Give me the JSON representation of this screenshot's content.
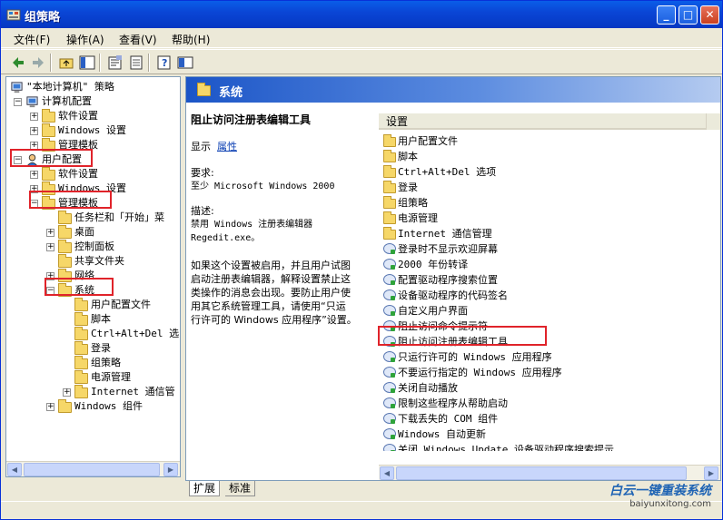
{
  "window": {
    "title": "组策略"
  },
  "menu": [
    "文件(F)",
    "操作(A)",
    "查看(V)",
    "帮助(H)"
  ],
  "tree": [
    {
      "label": "\"本地计算机\" 策略",
      "level": 0,
      "exp": "",
      "icon": "computer"
    },
    {
      "label": "计算机配置",
      "level": 1,
      "exp": "-",
      "icon": "computer"
    },
    {
      "label": "软件设置",
      "level": 2,
      "exp": "+",
      "icon": "folder"
    },
    {
      "label": "Windows 设置",
      "level": 2,
      "exp": "+",
      "icon": "folder"
    },
    {
      "label": "管理模板",
      "level": 2,
      "exp": "+",
      "icon": "folder"
    },
    {
      "label": "用户配置",
      "level": 1,
      "exp": "-",
      "icon": "user"
    },
    {
      "label": "软件设置",
      "level": 2,
      "exp": "+",
      "icon": "folder"
    },
    {
      "label": "Windows 设置",
      "level": 2,
      "exp": "+",
      "icon": "folder"
    },
    {
      "label": "管理模板",
      "level": 2,
      "exp": "-",
      "icon": "folder"
    },
    {
      "label": "任务栏和「开始」菜",
      "level": 3,
      "exp": "",
      "icon": "folder"
    },
    {
      "label": "桌面",
      "level": 3,
      "exp": "+",
      "icon": "folder"
    },
    {
      "label": "控制面板",
      "level": 3,
      "exp": "+",
      "icon": "folder"
    },
    {
      "label": "共享文件夹",
      "level": 3,
      "exp": "",
      "icon": "folder"
    },
    {
      "label": "网络",
      "level": 3,
      "exp": "+",
      "icon": "folder"
    },
    {
      "label": "系统",
      "level": 3,
      "exp": "-",
      "icon": "folder"
    },
    {
      "label": "用户配置文件",
      "level": 4,
      "exp": "",
      "icon": "folder"
    },
    {
      "label": "脚本",
      "level": 4,
      "exp": "",
      "icon": "folder"
    },
    {
      "label": "Ctrl+Alt+Del 选",
      "level": 4,
      "exp": "",
      "icon": "folder"
    },
    {
      "label": "登录",
      "level": 4,
      "exp": "",
      "icon": "folder"
    },
    {
      "label": "组策略",
      "level": 4,
      "exp": "",
      "icon": "folder"
    },
    {
      "label": "电源管理",
      "level": 4,
      "exp": "",
      "icon": "folder"
    },
    {
      "label": "Internet 通信管",
      "level": 4,
      "exp": "+",
      "icon": "folder"
    },
    {
      "label": "Windows 组件",
      "level": 3,
      "exp": "+",
      "icon": "folder"
    }
  ],
  "right_header": "系统",
  "description": {
    "title": "阻止访问注册表编辑工具",
    "show_label": "显示",
    "properties_link": "属性",
    "req_label": "要求:",
    "req_text": "至少 Microsoft Windows 2000",
    "desc_label": "描述:",
    "desc_lines": [
      "禁用 Windows 注册表编辑器",
      "Regedit.exe。",
      "",
      "如果这个设置被启用，并且用户试图",
      "启动注册表编辑器，解释设置禁止这",
      "类操作的消息会出现。要防止用户使",
      "用其它系统管理工具，请使用“只运",
      "行许可的 Windows 应用程序”设置。"
    ]
  },
  "list_header": "设置",
  "list": [
    {
      "label": "用户配置文件",
      "icon": "folder"
    },
    {
      "label": "脚本",
      "icon": "folder"
    },
    {
      "label": "Ctrl+Alt+Del 选项",
      "icon": "folder"
    },
    {
      "label": "登录",
      "icon": "folder"
    },
    {
      "label": "组策略",
      "icon": "folder"
    },
    {
      "label": "电源管理",
      "icon": "folder"
    },
    {
      "label": "Internet 通信管理",
      "icon": "folder"
    },
    {
      "label": "登录时不显示欢迎屏幕",
      "icon": "setting"
    },
    {
      "label": "2000 年份转译",
      "icon": "setting"
    },
    {
      "label": "配置驱动程序搜索位置",
      "icon": "setting"
    },
    {
      "label": "设备驱动程序的代码签名",
      "icon": "setting"
    },
    {
      "label": "自定义用户界面",
      "icon": "setting"
    },
    {
      "label": "阻止访问命令提示符",
      "icon": "setting"
    },
    {
      "label": "阻止访问注册表编辑工具",
      "icon": "setting"
    },
    {
      "label": "只运行许可的 Windows 应用程序",
      "icon": "setting"
    },
    {
      "label": "不要运行指定的 Windows 应用程序",
      "icon": "setting"
    },
    {
      "label": "关闭自动播放",
      "icon": "setting"
    },
    {
      "label": "限制这些程序从帮助启动",
      "icon": "setting"
    },
    {
      "label": "下载丢失的 COM 组件",
      "icon": "setting"
    },
    {
      "label": "Windows 自动更新",
      "icon": "setting"
    },
    {
      "label": "关闭 Windows Update 设备驱动程序搜索提示",
      "icon": "setting"
    }
  ],
  "tabs": [
    "扩展",
    "标准"
  ],
  "watermark": {
    "line1": "白云一键重装系统",
    "line2": "baiyunxitong.com"
  }
}
